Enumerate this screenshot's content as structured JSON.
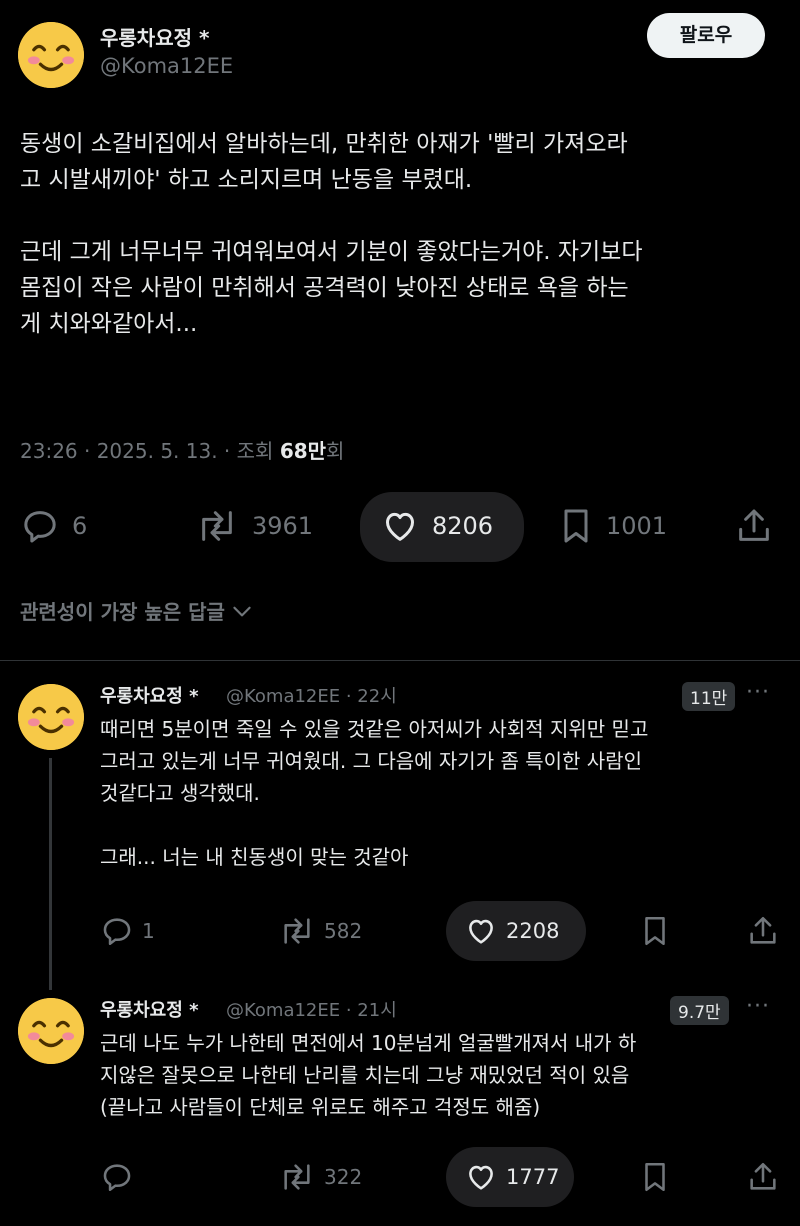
{
  "post": {
    "author_name": "우롱차요정 *",
    "handle": "@Koma12EE",
    "follow_label": "팔로우",
    "text_lines_1": "동생이 소갈비집에서 알바하는데, 만취한 아재가 '빨리 가져오라\n고 시발새끼야' 하고 소리지르며 난동을 부렸대.",
    "text_lines_2": "근데 그게 너무너무 귀여워보여서 기분이 좋았다는거야. 자기보다\n몸집이 작은 사람이 만취해서 공격력이 낮아진 상태로 욕을 하는\n게 치와와같아서...",
    "meta_prefix": "23:26 · 2025. 5. 13. · 조회 ",
    "views": "68만",
    "meta_suffix": "회",
    "replies": "6",
    "reposts": "3961",
    "likes": "8206",
    "bookmarks": "1001"
  },
  "section_title": "관련성이 가장 높은 답글",
  "replies": [
    {
      "author_name": "우롱차요정 *",
      "handle_time": "@Koma12EE · 22시",
      "badge": "11만",
      "text_1": "때리면 5분이면 죽일 수 있을 것같은 아저씨가 사회적 지위만 믿고\n그러고 있는게 너무 귀여웠대. 그 다음에 자기가 좀 특이한 사람인\n것같다고 생각했대.",
      "text_2": "그래... 너는 내 친동생이 맞는 것같아",
      "replies": "1",
      "reposts": "582",
      "likes": "2208"
    },
    {
      "author_name": "우롱차요정 *",
      "handle_time": "@Koma12EE · 21시",
      "badge": "9.7만",
      "text_1": "근데 나도 누가 나한테 면전에서 10분넘게 얼굴빨개져서 내가 하\n지않은 잘못으로 나한테 난리를 치는데 그냥 재밌었던 적이 있음\n(끝나고 사람들이 단체로 위로도 해주고 걱정도 해줌)",
      "replies": "",
      "reposts": "322",
      "likes": "1777"
    }
  ],
  "more_label": "···",
  "colors": {
    "background": "#000000",
    "text": "#e7e9ea",
    "muted": "#71767b",
    "avatar": "#f7c948"
  }
}
